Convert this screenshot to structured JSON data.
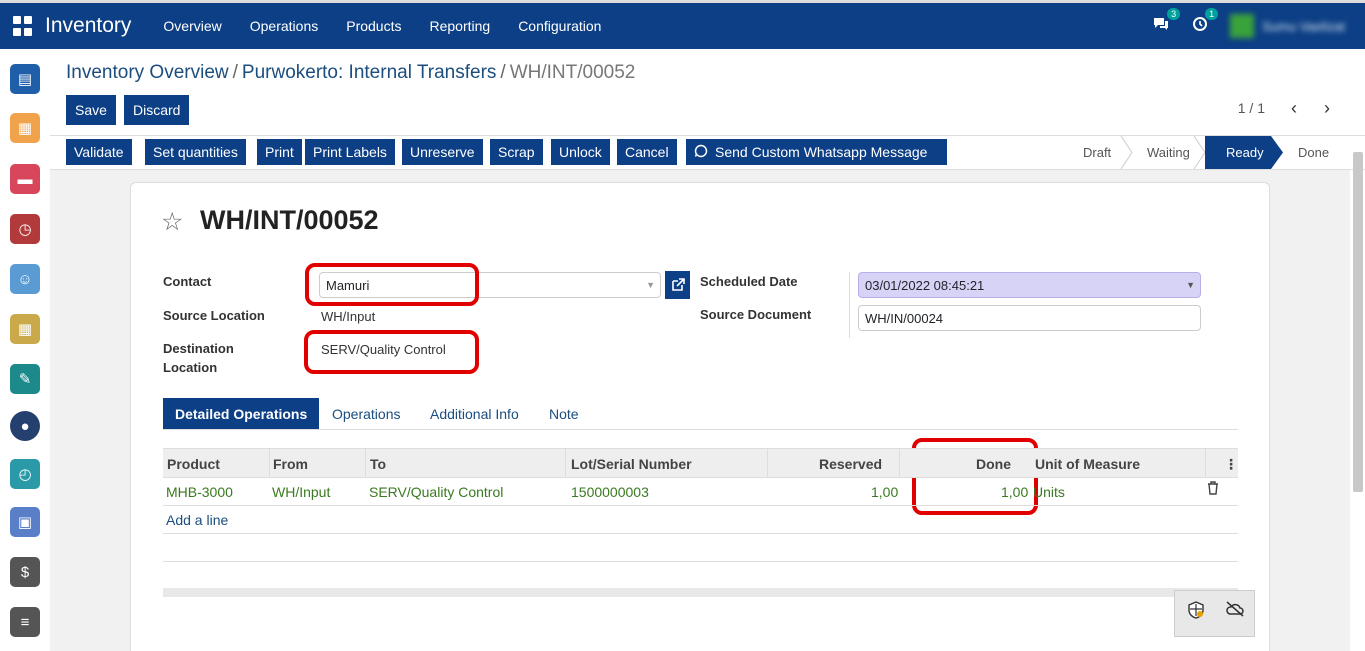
{
  "topbar": {
    "app_name": "Inventory",
    "menu": [
      "Overview",
      "Operations",
      "Products",
      "Reporting",
      "Configuration"
    ],
    "messages_count": "3",
    "activities_count": "1",
    "user_name": "Sumu Vaelizat"
  },
  "breadcrumb": {
    "level1": "Inventory Overview",
    "level2": "Purwokerto: Internal Transfers",
    "current": "WH/INT/00052",
    "separator": "/"
  },
  "controls": {
    "save": "Save",
    "discard": "Discard",
    "pager": "1 / 1"
  },
  "actions": [
    "Validate",
    "Set quantities",
    "Print",
    "Print Labels",
    "Unreserve",
    "Scrap",
    "Unlock",
    "Cancel",
    "Send Custom Whatsapp Message"
  ],
  "status": {
    "steps": [
      "Draft",
      "Waiting",
      "Ready",
      "Done"
    ],
    "active": "Ready"
  },
  "record": {
    "title": "WH/INT/00052",
    "contact_label": "Contact",
    "contact_value": "Mamuri",
    "source_location_label": "Source Location",
    "source_location_value": "WH/Input",
    "destination_label_1": "Destination",
    "destination_label_2": "Location",
    "destination_value": "SERV/Quality Control",
    "scheduled_date_label": "Scheduled Date",
    "scheduled_date_value": "03/01/2022 08:45:21",
    "source_document_label": "Source Document",
    "source_document_value": "WH/IN/00024"
  },
  "tabs": [
    "Detailed Operations",
    "Operations",
    "Additional Info",
    "Note"
  ],
  "table": {
    "headers": [
      "Product",
      "From",
      "To",
      "Lot/Serial Number",
      "Reserved",
      "Done",
      "Unit of Measure"
    ],
    "rows": [
      {
        "product": "MHB-3000",
        "from": "WH/Input",
        "to": "SERV/Quality Control",
        "lot": "1500000003",
        "reserved": "1,00",
        "done": "1,00",
        "uom": "Units"
      }
    ],
    "add_line": "Add a line"
  },
  "colors": {
    "primary": "#0c3f85",
    "highlight": "#e00000",
    "link_green": "#3a7a20"
  }
}
